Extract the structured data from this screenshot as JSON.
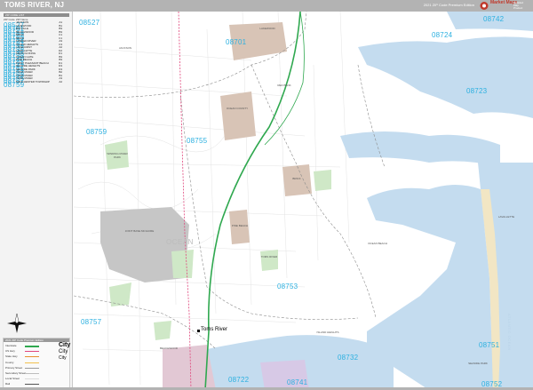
{
  "header": {
    "title": "TOMS RIVER, NJ",
    "subtitle": "2021 ZIP Code Premium Edition"
  },
  "logo": {
    "brand": "Market Maps",
    "tag": "Detailed Map Product"
  },
  "zip_index": {
    "heading": "ZIP CODE LIST",
    "col_zip": "ZIP Code",
    "col_name": "ZIP Name",
    "rows": [
      {
        "zip": "08527",
        "name": "JACKSON",
        "page": "A1"
      },
      {
        "zip": "08701",
        "name": "LAKEWOOD",
        "page": "B1"
      },
      {
        "zip": "08721",
        "name": "BAYVILLE",
        "page": "B3"
      },
      {
        "zip": "08722",
        "name": "BEACHWOOD",
        "page": "B3"
      },
      {
        "zip": "08723",
        "name": "BRICK",
        "page": "C1"
      },
      {
        "zip": "08724",
        "name": "BRICK",
        "page": "C1"
      },
      {
        "zip": "08731",
        "name": "FORKED RIVER",
        "page": "A3"
      },
      {
        "zip": "08732",
        "name": "ISLAND HEIGHTS",
        "page": "C3"
      },
      {
        "zip": "08733",
        "name": "LAKEHURST",
        "page": "A2"
      },
      {
        "zip": "08735",
        "name": "LAVALLETTE",
        "page": "D2"
      },
      {
        "zip": "08738",
        "name": "MANTOLOKING",
        "page": "D1"
      },
      {
        "zip": "08740",
        "name": "OCEAN GATE",
        "page": "B3"
      },
      {
        "zip": "08741",
        "name": "PINE BEACH",
        "page": "B3"
      },
      {
        "zip": "08742",
        "name": "POINT PLEASANT BEACH",
        "page": "D1"
      },
      {
        "zip": "08751",
        "name": "SEASIDE HEIGHTS",
        "page": "D3"
      },
      {
        "zip": "08752",
        "name": "SEASIDE PARK",
        "page": "D3"
      },
      {
        "zip": "08753",
        "name": "TOMS RIVER",
        "page": "B2"
      },
      {
        "zip": "08755",
        "name": "TOMS RIVER",
        "page": "B1"
      },
      {
        "zip": "08757",
        "name": "TOMS RIVER",
        "page": "A3"
      },
      {
        "zip": "08759",
        "name": "MANCHESTER TOWNSHIP",
        "page": "A2"
      }
    ]
  },
  "legend": {
    "heading": "2021 ZIP Code Premium Edition",
    "rows": [
      "Interstate",
      "US Hwy",
      "State Hwy",
      "County",
      "Primary Street",
      "Secondary Street",
      "Local Street",
      "Rail",
      "ZIP Boundary",
      "County Bdry"
    ],
    "city_samples": [
      "City",
      "City",
      "City"
    ]
  },
  "map": {
    "zips": [
      "08527",
      "08701",
      "08742",
      "08724",
      "08723",
      "08759",
      "08755",
      "08753",
      "08757",
      "08751",
      "08732",
      "08722",
      "08741",
      "08752"
    ],
    "water_labels": [
      "OCEAN",
      "ATLANTIC OCEAN"
    ],
    "city_label": "Toms River",
    "places": [
      "LAKEWOOD",
      "JACKSON",
      "RED BANK",
      "OCEAN COUNTY",
      "WINDING RIVER PARK",
      "JOINT BASE MCGUIRE",
      "BRICK",
      "PINE BEACH",
      "TOMS RIVER",
      "OCEAN BEACH",
      "ISLAND HEIGHTS",
      "BEACHWOOD",
      "SEASIDE PARK",
      "LAVALLETTE"
    ]
  },
  "colors": {
    "zip_label": "#2cb0e0",
    "water": "#c4dcef",
    "land": "#ffffff",
    "park": "#cfe8c7",
    "urban": "#d8c4b6",
    "military": "#c6c6c6",
    "highway": "#2fa84f",
    "route": "#e0457b"
  }
}
